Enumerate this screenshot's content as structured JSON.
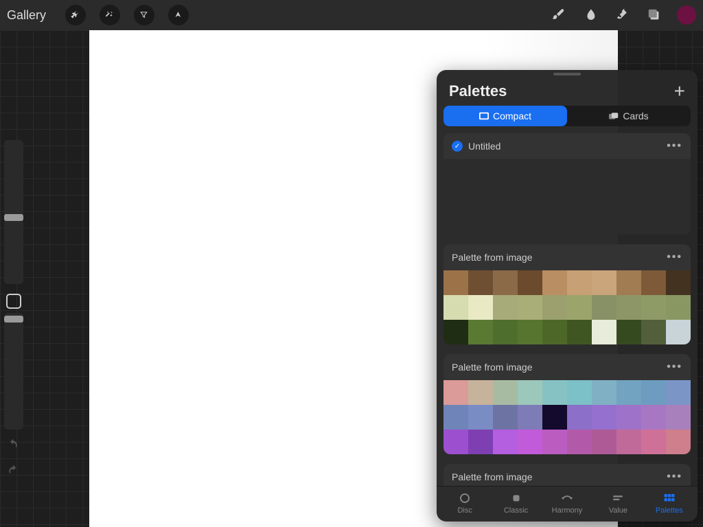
{
  "topbar": {
    "gallery_label": "Gallery",
    "current_color": "#6d1042"
  },
  "panel": {
    "title": "Palettes",
    "view_toggle": {
      "compact_label": "Compact",
      "cards_label": "Cards",
      "active": "compact"
    },
    "bottom_nav": {
      "disc": "Disc",
      "classic": "Classic",
      "harmony": "Harmony",
      "value": "Value",
      "palettes": "Palettes",
      "active": "palettes"
    }
  },
  "palettes": [
    {
      "name": "Untitled",
      "selected": true,
      "swatches": []
    },
    {
      "name": "Palette from image",
      "selected": false,
      "swatches": [
        "#9c7249",
        "#6e4f32",
        "#8b6a47",
        "#6b4a2d",
        "#b88e62",
        "#c7a076",
        "#caa47b",
        "#a17c53",
        "#7e5a38",
        "#42321f",
        "#d6dbb0",
        "#e9e9c4",
        "#a7aa79",
        "#a9ad77",
        "#9ba06e",
        "#9ba56b",
        "#889165",
        "#8c9666",
        "#8e9b67",
        "#899862",
        "#202d15",
        "#5a7a34",
        "#4d6e2c",
        "#57752f",
        "#4d6729",
        "#3f5622",
        "#e8ecda",
        "#364a1f",
        "#535f3a",
        "#c9d4d8"
      ]
    },
    {
      "name": "Palette from image",
      "selected": false,
      "swatches": [
        "#da9b99",
        "#c7b29c",
        "#a7bba3",
        "#9cc7bb",
        "#86c2c3",
        "#7cc0c8",
        "#80b0c3",
        "#72a3c0",
        "#6e9cc1",
        "#7a95c6",
        "#6f84b8",
        "#7a8cc4",
        "#6d74a3",
        "#7e7cb6",
        "#130a2d",
        "#8b6fc8",
        "#9570cf",
        "#9f72c9",
        "#a877c4",
        "#a880bb",
        "#9c4fcf",
        "#7e3fb3",
        "#b45ee0",
        "#c25bd9",
        "#bb5cc0",
        "#b25aa9",
        "#ad5a96",
        "#c06a9a",
        "#cf7098",
        "#cf7e8c"
      ]
    },
    {
      "name": "Palette from image",
      "selected": false,
      "swatches": []
    }
  ]
}
